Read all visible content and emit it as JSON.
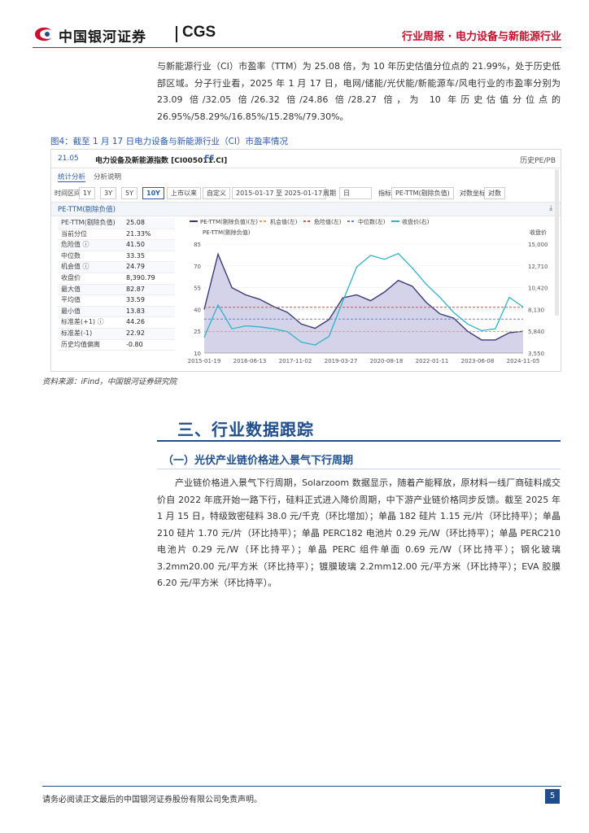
{
  "header": {
    "logo_cn": "中国银河证券",
    "logo_en": "CGS",
    "right_title": "行业周报 · 电力设备与新能源行业"
  },
  "intro_paragraph": "与新能源行业（CI）市盈率（TTM）为 25.08 倍，为 10 年历史估值分位点的 21.99%，处于历史低部区域。分子行业看，2025 年 1 月 17 日，电网/储能/光伏能/新能源车/风电行业的市盈率分别为 23.09 倍/32.05 倍/26.32 倍/24.86 倍/28.27 倍，为 10 年历史估值分位点的 26.95%/58.29%/16.85%/15.28%/79.30%。",
  "figure": {
    "title": "图4：截至 1 月 17 日电力设备与新能源行业（CI）市盈率情况",
    "code": "21.05",
    "index_name": "电力设备及新能源指数 [CI005011.CI]",
    "f5": "F5",
    "top_right": "历史PE/PB",
    "tabs": [
      "统计分析",
      "分析说明"
    ],
    "controls": {
      "time_label": "时间区间",
      "ranges": [
        "1Y",
        "3Y",
        "5Y",
        "10Y",
        "上市以来",
        "自定义"
      ],
      "date_range": "2015-01-17 至 2025-01-17",
      "freq_label": "周期",
      "freq_value": "日",
      "metric_label": "指标",
      "metric_value": "PE-TTM(剔除负值)",
      "scale_label": "对数坐标",
      "scale_value": "对数"
    },
    "panel_title": "PE-TTM(剔除负值)",
    "download": "⤓",
    "stats": [
      {
        "label": "PE-TTM(剔除负值)",
        "value": "25.08"
      },
      {
        "label": "当前分位",
        "value": "21.33%"
      },
      {
        "label": "危险值 ⓘ",
        "value": "41.50"
      },
      {
        "label": "中位数",
        "value": "33.35"
      },
      {
        "label": "机会值 ⓘ",
        "value": "24.79"
      },
      {
        "label": "收盘价",
        "value": "8,390.79"
      },
      {
        "label": "最大值",
        "value": "82.87"
      },
      {
        "label": "平均值",
        "value": "33.59"
      },
      {
        "label": "最小值",
        "value": "13.83"
      },
      {
        "label": "标准差(+1) ⓘ",
        "value": "44.26"
      },
      {
        "label": "标准差(-1)",
        "value": "22.92"
      },
      {
        "label": "历史均值偏离",
        "value": "-0.80"
      }
    ]
  },
  "source": "资料来源：iFind，中国银河证券研究院",
  "section_title": "三、行业数据跟踪",
  "subsection_title": "（一）光伏产业链价格进入景气下行周期",
  "body_paragraph": "产业链价格进入景气下行周期，Solarzoom 数据显示，随着产能释放，原材料一线厂商硅料成交价自 2022 年底开始一路下行，硅料正式进入降价周期，中下游产业链价格同步反馈。截至 2025 年 1 月 15 日，特级致密硅料 38.0 元/千克（环比增加）；单晶 182 硅片 1.15 元/片（环比持平）；单晶 210 硅片 1.70 元/片（环比持平）；单晶 PERC182 电池片 0.29 元/W（环比持平）；单晶 PERC210 电池片 0.29 元/W（环比持平）；单晶 PERC 组件单面 0.69 元/W（环比持平）；钢化玻璃 3.2mm20.00 元/平方米（环比持平）；镀膜玻璃 2.2mm12.00 元/平方米（环比持平）；EVA 胶膜 6.20 元/平方米（环比持平）。",
  "footer": {
    "disclaimer": "请务必阅读正文最后的中国银河证券股份有限公司免责声明。",
    "page_number": "5"
  },
  "chart_data": {
    "type": "line",
    "legend": [
      "PE-TTM(剔除负值)(左)",
      "机会值(左)",
      "危险值(左)",
      "中位数(左)",
      "收盘价(右)"
    ],
    "left_axis_title": "PE-TTM(剔除负值)",
    "right_axis_title": "收盘价",
    "left_ticks": [
      10,
      25,
      40,
      55,
      70,
      85
    ],
    "right_ticks": [
      "3,550",
      "5,840",
      "8,130",
      "10,420",
      "12,710",
      "15,000"
    ],
    "ylim_left": [
      10,
      85
    ],
    "ylim_right": [
      3550,
      15000
    ],
    "x_ticks": [
      "2015-01-19",
      "2016-06-13",
      "2017-11-02",
      "2019-03-27",
      "2020-08-18",
      "2022-01-11",
      "2023-06-08",
      "2024-11-05"
    ],
    "lines": {
      "机会值": 24.79,
      "危险值": 41.5,
      "中位数": 33.35
    },
    "series": [
      {
        "name": "PE-TTM(剔除负值)(左)",
        "values": [
          40,
          78,
          55,
          50,
          47,
          42,
          38,
          30,
          27,
          33,
          48,
          50,
          46,
          52,
          60,
          56,
          45,
          37,
          34,
          25,
          19,
          19,
          24,
          25
        ]
      },
      {
        "name": "收盘价(右)",
        "values": [
          5200,
          8600,
          6100,
          6400,
          6300,
          6100,
          5800,
          4700,
          4400,
          5300,
          9000,
          12600,
          13800,
          13400,
          14000,
          12500,
          10800,
          9400,
          7800,
          6600,
          5900,
          6100,
          9400,
          8390
        ]
      }
    ],
    "colors": {
      "pe": "#3b3a78",
      "pe_fill": "#c9c8e4",
      "price": "#2fb3c8",
      "opportunity": "#e8a04a",
      "danger": "#d94a4a",
      "median": "#6a83c8"
    }
  }
}
